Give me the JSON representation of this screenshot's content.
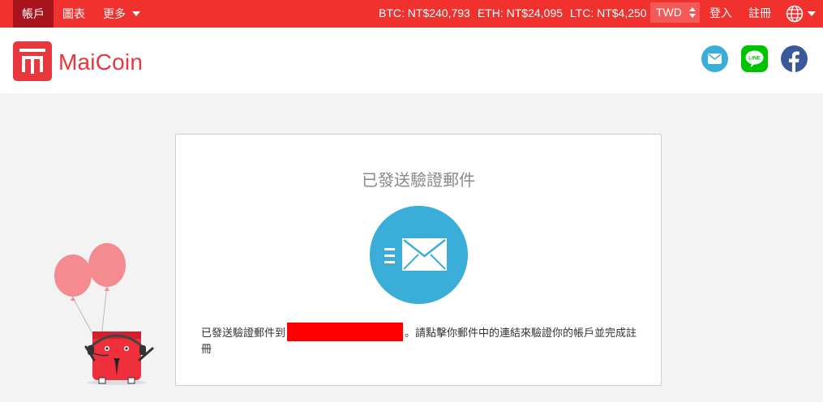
{
  "topbar": {
    "nav": [
      {
        "label": "帳戶",
        "active": true
      },
      {
        "label": "圖表",
        "active": false
      },
      {
        "label": "更多",
        "active": false,
        "dropdown": true
      }
    ],
    "prices": {
      "btc": "BTC: NT$240,793",
      "eth": "ETH: NT$24,095",
      "ltc": "LTC: NT$4,250"
    },
    "currency": "TWD",
    "login": "登入",
    "register": "註冊",
    "language_icon": "globe-icon"
  },
  "header": {
    "brand": "MaiCoin",
    "social": [
      "mail-icon",
      "line-icon",
      "facebook-icon"
    ]
  },
  "card": {
    "title": "已發送驗證郵件",
    "message_before": "已發送驗證郵件到",
    "message_after": "。請點擊你郵件中的連結來驗證你的帳戶並完成註冊"
  },
  "colors": {
    "brand_red": "#f0312e",
    "active_tab": "#a8141b",
    "envelope_blue": "#3aaed8"
  }
}
